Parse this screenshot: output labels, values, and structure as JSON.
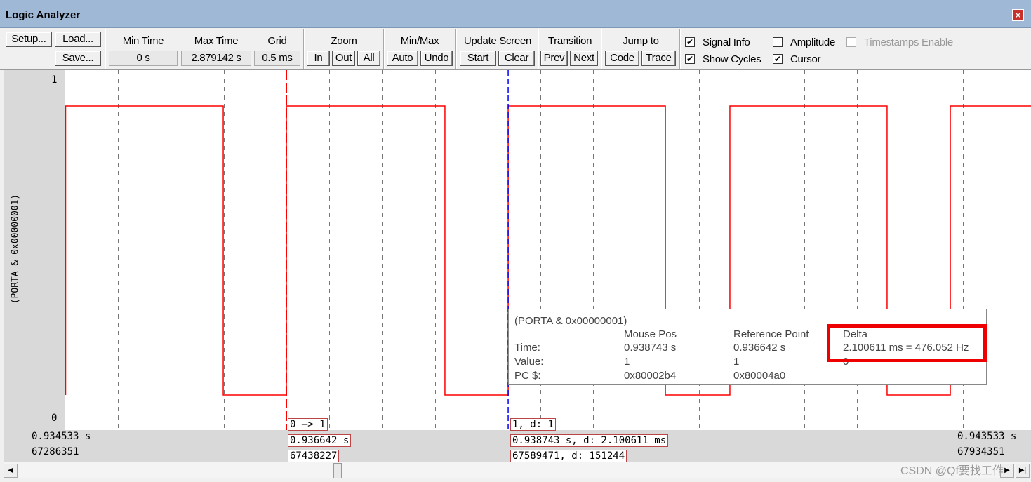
{
  "window": {
    "title": "Logic Analyzer",
    "close_icon": "close-icon"
  },
  "toolbar": {
    "setup": "Setup...",
    "load": "Load...",
    "save": "Save...",
    "min_time_label": "Min Time",
    "min_time": "0 s",
    "max_time_label": "Max Time",
    "max_time": "2.879142 s",
    "grid_label": "Grid",
    "grid": "0.5 ms",
    "zoom_label": "Zoom",
    "zoom_in": "In",
    "zoom_out": "Out",
    "zoom_all": "All",
    "minmax_label": "Min/Max",
    "auto": "Auto",
    "undo": "Undo",
    "update_label": "Update Screen",
    "start": "Start",
    "clear": "Clear",
    "transition_label": "Transition",
    "prev": "Prev",
    "next": "Next",
    "jump_label": "Jump to",
    "code": "Code",
    "trace": "Trace",
    "signal_info": {
      "label": "Signal Info",
      "checked": true
    },
    "show_cycles": {
      "label": "Show Cycles",
      "checked": true
    },
    "amplitude": {
      "label": "Amplitude",
      "checked": false
    },
    "cursor": {
      "label": "Cursor",
      "checked": true
    },
    "timestamps": {
      "label": "Timestamps Enable",
      "checked": false,
      "disabled": true
    }
  },
  "signal": {
    "name": "(PORTA & 0x00000001)",
    "y_max": "1",
    "y_min": "0",
    "color": "#ff0000",
    "view_start_s": 0.934548,
    "grid_ms": 0.5,
    "initial_level": 1,
    "edges_s": [
      0.936044,
      0.936642,
      0.938144,
      0.938743,
      0.940232,
      0.940843,
      0.942332,
      0.942931
    ]
  },
  "cursors": {
    "reference_color": "#ff0000",
    "mouse_color": "#0000ff",
    "ref_transition": "0 —> 1",
    "ref_time": "0.936642 s",
    "ref_cycles": "67438227",
    "mouse_value": "1,   d: 1",
    "mouse_time": "0.938743 s,   d: 2.100611 ms",
    "mouse_cycles": "67589471,   d: 151244"
  },
  "axis": {
    "left_time": "0.934533 s",
    "left_cycles": "67286351",
    "right_time": "0.943533 s",
    "right_cycles": "67934351"
  },
  "info": {
    "title": "(PORTA & 0x00000001)",
    "col_mouse": "Mouse Pos",
    "col_ref": "Reference Point",
    "col_delta": "Delta",
    "row_time": "Time:",
    "row_value": "Value:",
    "row_pc": "PC $:",
    "mouse_time": "0.938743 s",
    "ref_time": "0.936642 s",
    "delta_time": "2.100611 ms = 476.052 Hz",
    "mouse_value": "1",
    "ref_value": "1",
    "delta_value": "0",
    "mouse_pc": "0x80002b4",
    "ref_pc": "0x80004a0"
  },
  "watermark": "CSDN @Qf要找工作"
}
